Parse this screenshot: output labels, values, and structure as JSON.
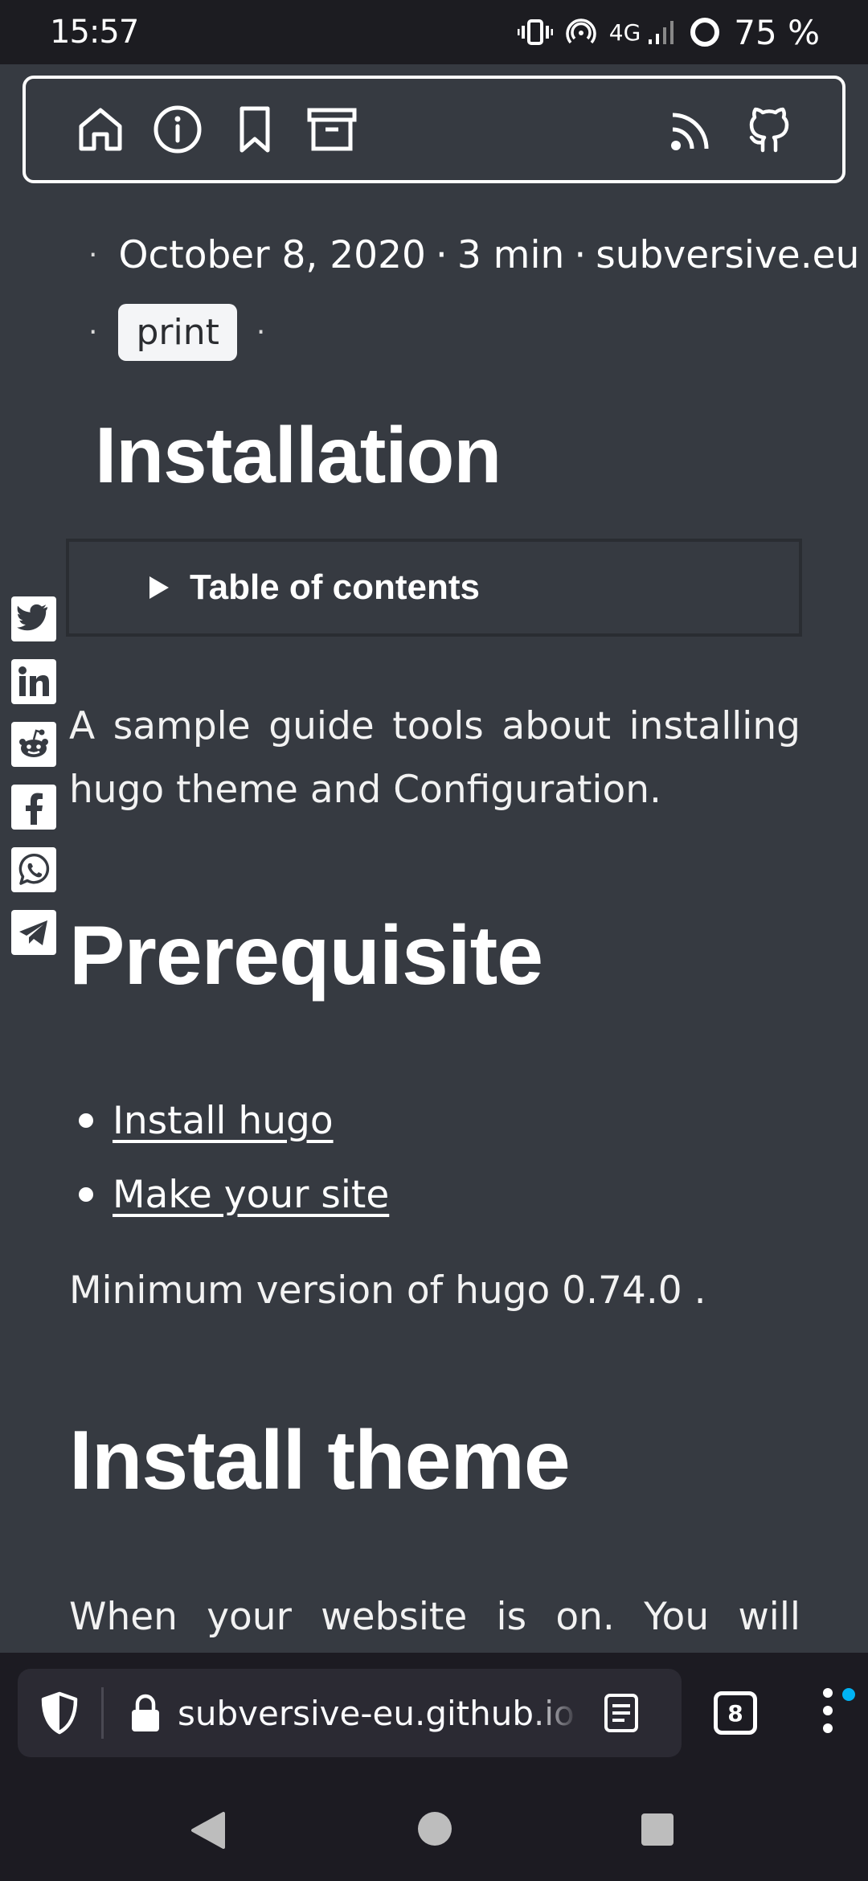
{
  "status_bar": {
    "time": "15:57",
    "network": "4G",
    "battery": "75 %"
  },
  "header": {
    "nav_icons": [
      "home-icon",
      "info-icon",
      "bookmark-icon",
      "archive-icon"
    ],
    "right_icons": [
      "rss-icon",
      "github-icon"
    ]
  },
  "post_meta": {
    "separator": "·",
    "date": "October 8, 2020",
    "reading_time": "3 min",
    "author": "subversive.eu",
    "tag": "print"
  },
  "article": {
    "title": "Installation",
    "toc_label": "Table of contents",
    "intro": "A sample guide tools about installing hugo theme and Configuration.",
    "prereq_heading": "Prerequisite",
    "prereq_items": [
      "Install hugo",
      "Make your site"
    ],
    "min_version": "Minimum version of hugo 0.74.0 .",
    "install_heading": "Install theme",
    "install_text": "When your website is on. You will install"
  },
  "share": [
    "twitter-icon",
    "linkedin-icon",
    "reddit-icon",
    "facebook-icon",
    "whatsapp-icon",
    "telegram-icon"
  ],
  "browser": {
    "url": "subversive-eu.github.io",
    "tab_count": "8",
    "notification_color": "#00b3f4"
  },
  "colors": {
    "page_bg": "#363a41",
    "bar_bg": "#1c1b22",
    "text": "#ffffff"
  }
}
